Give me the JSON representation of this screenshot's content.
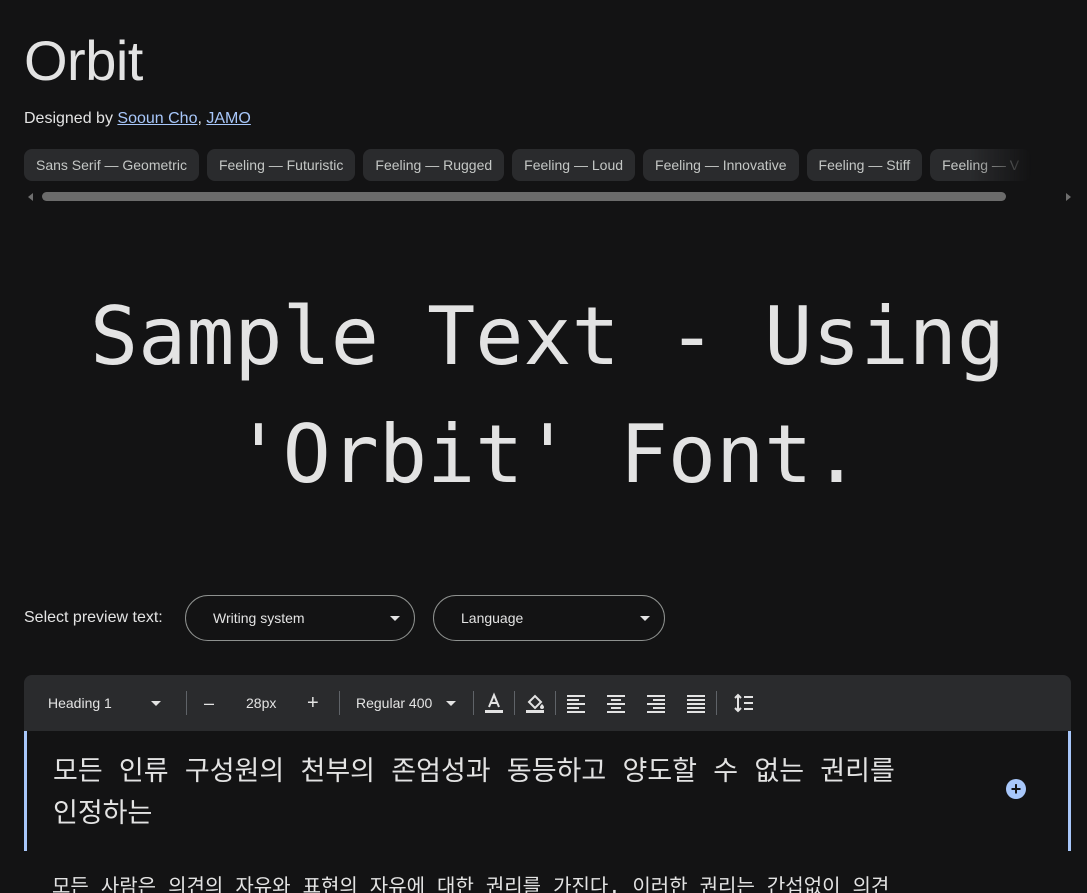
{
  "font": {
    "name": "Orbit",
    "designed_by_prefix": "Designed by",
    "designers": [
      "Sooun Cho",
      "JAMO"
    ],
    "designer_separator": ","
  },
  "tags": [
    "Sans Serif — Geometric",
    "Feeling — Futuristic",
    "Feeling — Rugged",
    "Feeling — Loud",
    "Feeling — Innovative",
    "Feeling — Stiff",
    "Feeling — V"
  ],
  "sample_text": "Sample Text - Using 'Orbit' Font.",
  "preview": {
    "label": "Select preview text:",
    "writing_system_placeholder": "Writing system",
    "language_placeholder": "Language"
  },
  "toolbar": {
    "style": "Heading 1",
    "decrease": "–",
    "size": "28px",
    "increase": "+",
    "weight": "Regular 400"
  },
  "editor": {
    "heading": "모든 인류 구성원의 천부의 존엄성과 동등하고 양도할 수 없는 권리를 인정하는",
    "add_button": "+",
    "paragraph": "모든 사람은 의견의 자유와 표현의 자유에 대한 권리를 가진다. 이러한 권리는 간섭없이 의견"
  },
  "colors": {
    "background": "#131314",
    "chip": "#2a2b2d",
    "link": "#a8c7fa",
    "text": "#e3e3e3"
  }
}
